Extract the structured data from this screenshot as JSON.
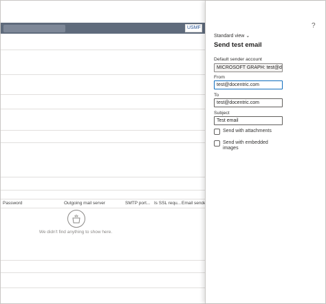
{
  "background": {
    "company": "USMF | G",
    "grid_columns": [
      "Password",
      "Outgoing mail server",
      "SMTP port...",
      "Is SSL requ...",
      "Email sende"
    ],
    "empty_message": "We didn't find anything to show here."
  },
  "panel": {
    "help": "?",
    "view": "Standard view",
    "title": "Send test email",
    "default_sender_label": "Default sender account",
    "default_sender_value": "MICROSOFT GRAPH: test@d...",
    "from_label": "From",
    "from_value": "test@docentric.com",
    "to_label": "To",
    "to_value": "test@docentric.com",
    "subject_label": "Subject",
    "subject_value": "Test email",
    "attachments_label": "Send with attachments",
    "attachments_checked": false,
    "embedded_label": "Send with embedded images",
    "embedded_checked": false
  },
  "colors": {
    "topbar": "#5f6b7c",
    "focus": "#0f6cbd"
  }
}
